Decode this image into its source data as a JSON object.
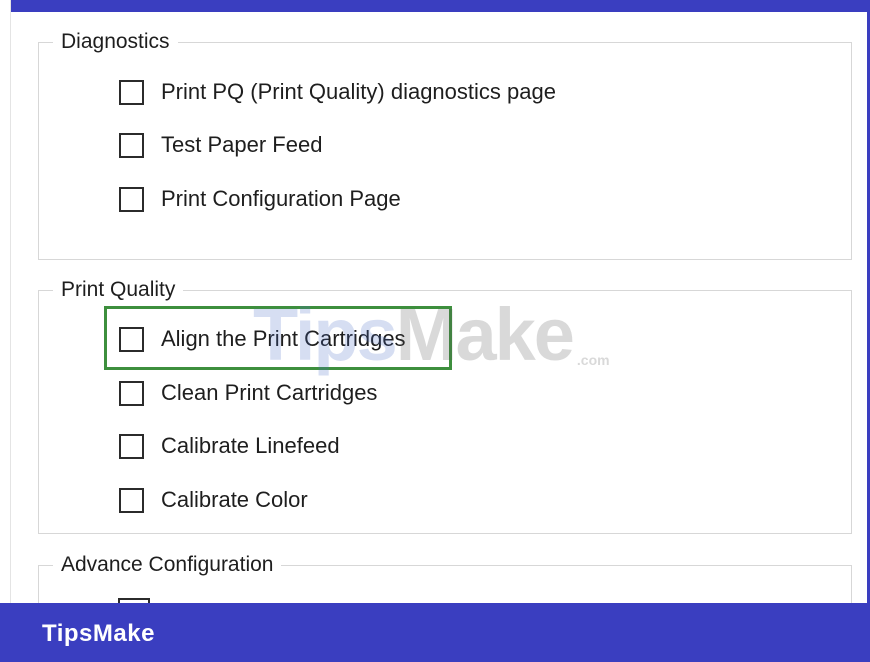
{
  "groups": {
    "diagnostics": {
      "legend": "Diagnostics",
      "options": [
        "Print PQ (Print Quality) diagnostics page",
        "Test Paper Feed",
        "Print Configuration Page"
      ]
    },
    "print_quality": {
      "legend": "Print Quality",
      "options": [
        "Align the Print Cartridges",
        "Clean Print Cartridges",
        "Calibrate Linefeed",
        "Calibrate Color"
      ],
      "highlighted_option": "Align the Print Cartridges"
    },
    "advance_configuration": {
      "legend": "Advance Configuration"
    }
  },
  "watermark": {
    "part1": "Tips",
    "part2": "M",
    "part3": "ake",
    "suffix": ".com"
  },
  "footer": {
    "brand": "TipsMake"
  },
  "colors": {
    "frame": "#3a3ec0",
    "highlight": "#3d8f3d",
    "footer_text": "#ffffff"
  }
}
